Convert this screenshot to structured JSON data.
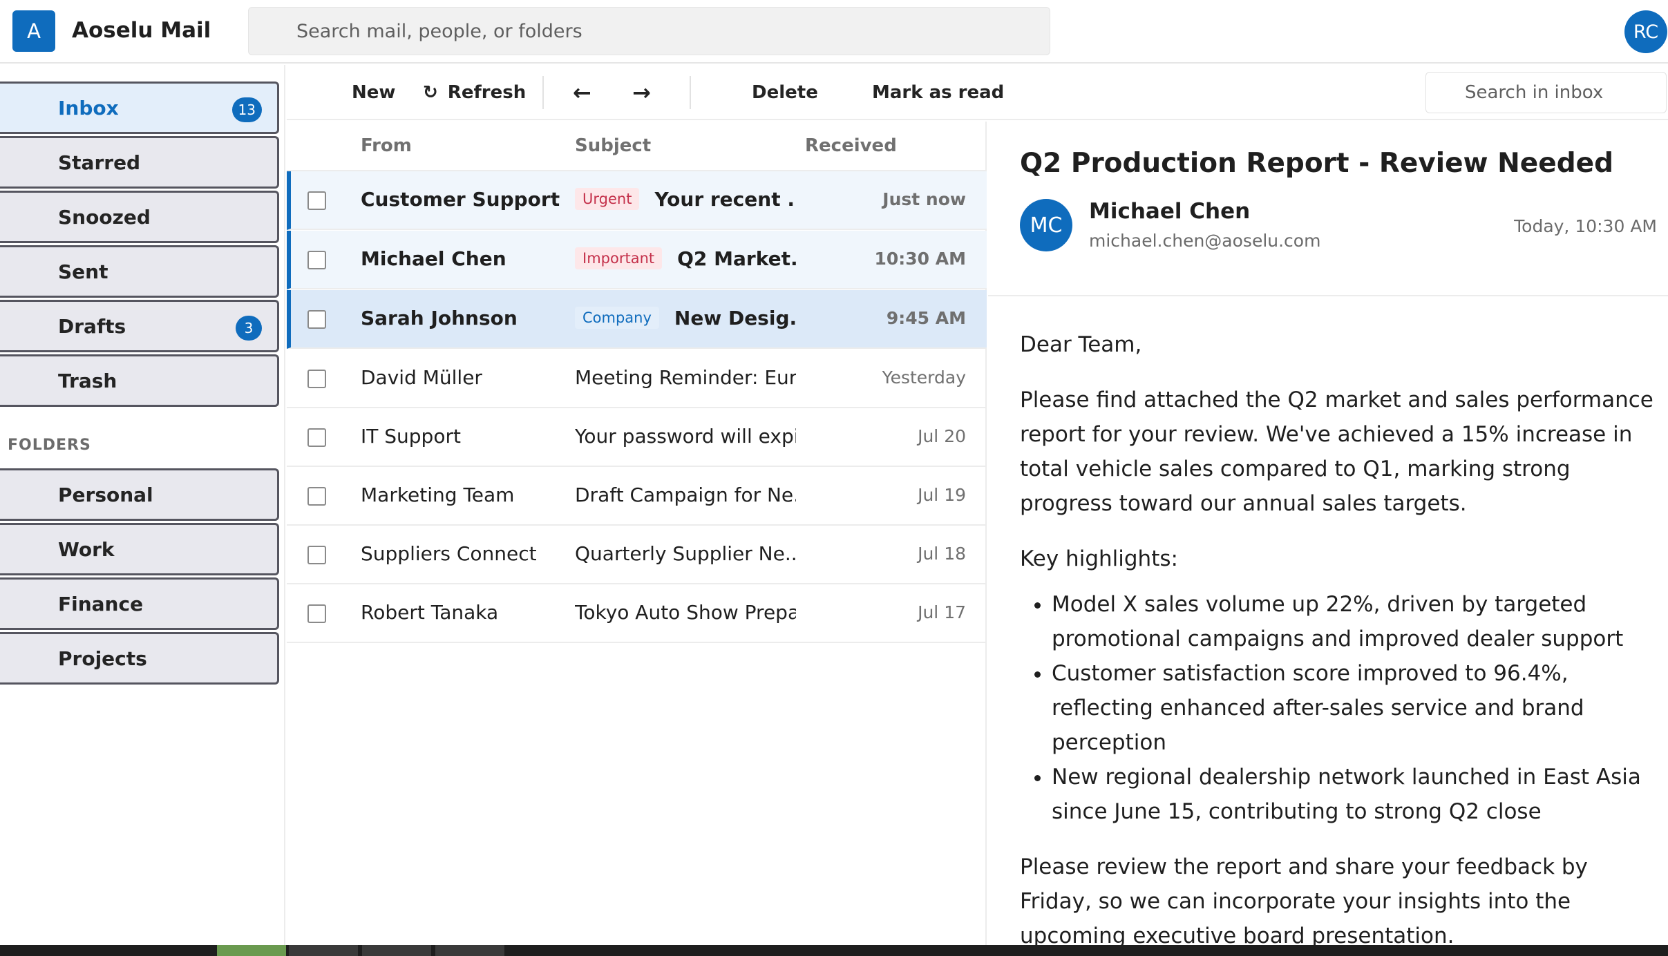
{
  "app": {
    "logo_letter": "A",
    "title": "Aoselu Mail",
    "search_placeholder": "Search mail, people, or folders",
    "user_initials": "RC"
  },
  "sidebar": {
    "items": [
      {
        "label": "Inbox",
        "badge": "13",
        "active": true
      },
      {
        "label": "Starred",
        "badge": ""
      },
      {
        "label": "Snoozed",
        "badge": ""
      },
      {
        "label": "Sent",
        "badge": ""
      },
      {
        "label": "Drafts",
        "badge": "3"
      },
      {
        "label": "Trash",
        "badge": ""
      }
    ],
    "folders_heading": "FOLDERS",
    "folders": [
      {
        "label": "Personal"
      },
      {
        "label": "Work"
      },
      {
        "label": "Finance"
      },
      {
        "label": "Projects"
      }
    ]
  },
  "toolbar": {
    "new_label": "New",
    "refresh_icon": "↻",
    "refresh_label": "Refresh",
    "back_icon": "←",
    "forward_icon": "→",
    "delete_label": "Delete",
    "mark_read_label": "Mark as read",
    "inbox_search_placeholder": "Search in inbox"
  },
  "list": {
    "headers": {
      "from": "From",
      "subject": "Subject",
      "received": "Received"
    },
    "rows": [
      {
        "from": "Customer Support",
        "tag": "Urgent",
        "subject": "Your recent ...",
        "time": "Just now",
        "unread": true
      },
      {
        "from": "Michael Chen",
        "tag": "Important",
        "subject": "Q2 Market...",
        "time": "10:30 AM",
        "unread": true
      },
      {
        "from": "Sarah Johnson",
        "tag": "Company",
        "subject": "New Desig...",
        "time": "9:45 AM",
        "unread": true,
        "selected": true
      },
      {
        "from": "David Müller",
        "tag": "",
        "subject": "Meeting Reminder: Eur...",
        "time": "Yesterday"
      },
      {
        "from": "IT Support",
        "tag": "",
        "subject": "Your password will expi...",
        "time": "Jul 20"
      },
      {
        "from": "Marketing Team",
        "tag": "",
        "subject": "Draft Campaign for Ne...",
        "time": "Jul 19"
      },
      {
        "from": "Suppliers Connect",
        "tag": "",
        "subject": "Quarterly Supplier Ne...",
        "time": "Jul 18"
      },
      {
        "from": "Robert Tanaka",
        "tag": "",
        "subject": "Tokyo Auto Show Prepa...",
        "time": "Jul 17"
      }
    ]
  },
  "reader": {
    "subject": "Q2 Production Report - Review Needed",
    "sender_initials": "MC",
    "sender_name": "Michael Chen",
    "sender_email": "michael.chen@aoselu.com",
    "date": "Today, 10:30 AM",
    "greeting": "Dear Team,",
    "para1": "Please find attached the Q2 market and sales performance report for your review. We've achieved a 15% increase in total vehicle sales compared to Q1, marking strong progress toward our annual sales targets.",
    "highlights_heading": "Key highlights:",
    "highlights": [
      "Model X sales volume up 22%, driven by targeted promotional campaigns and improved dealer support",
      "Customer satisfaction score improved to 96.4%, reflecting enhanced after-sales service and brand perception",
      "New regional dealership network launched in East Asia since June 15, contributing to strong Q2 close"
    ],
    "para2": "Please review the report and share your feedback by Friday, so we can incorporate your insights into the upcoming executive board presentation."
  },
  "colors": {
    "accent": "#0f6cbd",
    "urgent_tag": "#c4314b",
    "urgent_tag_bg": "#fde7e9",
    "company_tag_bg": "#e3eefa"
  }
}
